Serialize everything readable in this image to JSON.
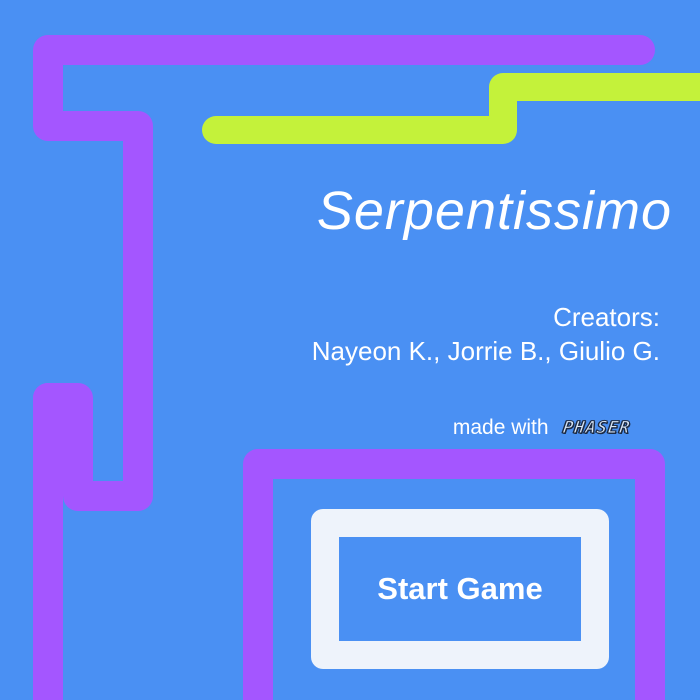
{
  "colors": {
    "background": "#4a90f3",
    "snake_primary": "#a456ff",
    "snake_secondary": "#c4f23a",
    "button_frame": "#eef3fb",
    "text": "#ffffff"
  },
  "title": "Serpentissimo",
  "credits": {
    "label": "Creators:",
    "names": "Nayeon K., Jorrie B., Giulio G."
  },
  "made_with": {
    "label": "made with",
    "logo_text": "PHASER"
  },
  "start_button": {
    "label": "Start Game"
  }
}
